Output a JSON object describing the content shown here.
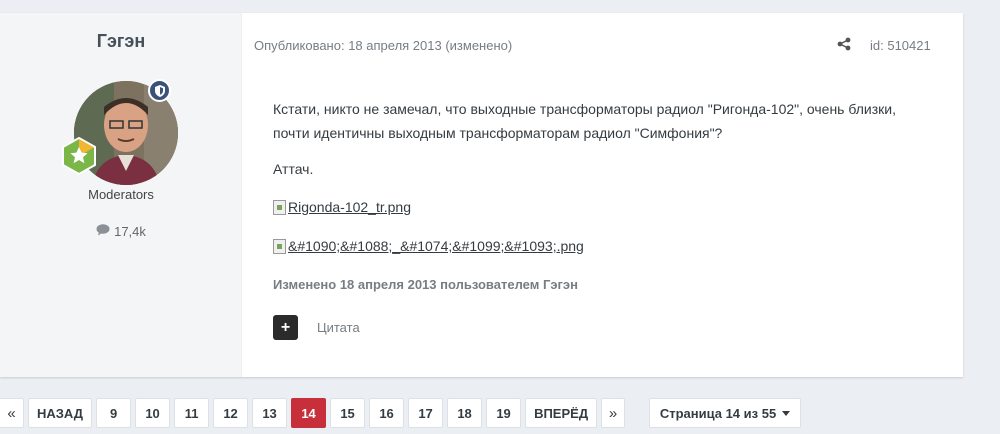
{
  "author": {
    "name": "Гэгэн",
    "group": "Moderators",
    "post_count": "17,4k"
  },
  "post": {
    "published": "Опубликовано: 18 апреля 2013 (изменено)",
    "id_label": "id: 510421",
    "body_text": "Кстати, никто не замечал, что выходные трансформаторы радиол \"Ригонда-102\", очень близки, почти идентичны выходным трансформаторам радиол \"Симфония\"?",
    "attach_label": "Аттач.",
    "image1_alt": "Rigonda-102_tr.png",
    "image2_alt": "&#1090;&#1088;_&#1074;&#1099;&#1093;.png",
    "edited_note": "Изменено 18 апреля 2013 пользователем Гэгэн",
    "quote_button": "+",
    "quote_label": "Цитата"
  },
  "pagination": {
    "first": "«",
    "prev": "НАЗАД",
    "pages": [
      "9",
      "10",
      "11",
      "12",
      "13",
      "14",
      "15",
      "16",
      "17",
      "18",
      "19"
    ],
    "current": "14",
    "next": "ВПЕРЁД",
    "last": "»",
    "page_jump": "Страница 14 из 55"
  },
  "colors": {
    "accent": "#c72f3a",
    "moderator_badge": "#3a5278"
  }
}
